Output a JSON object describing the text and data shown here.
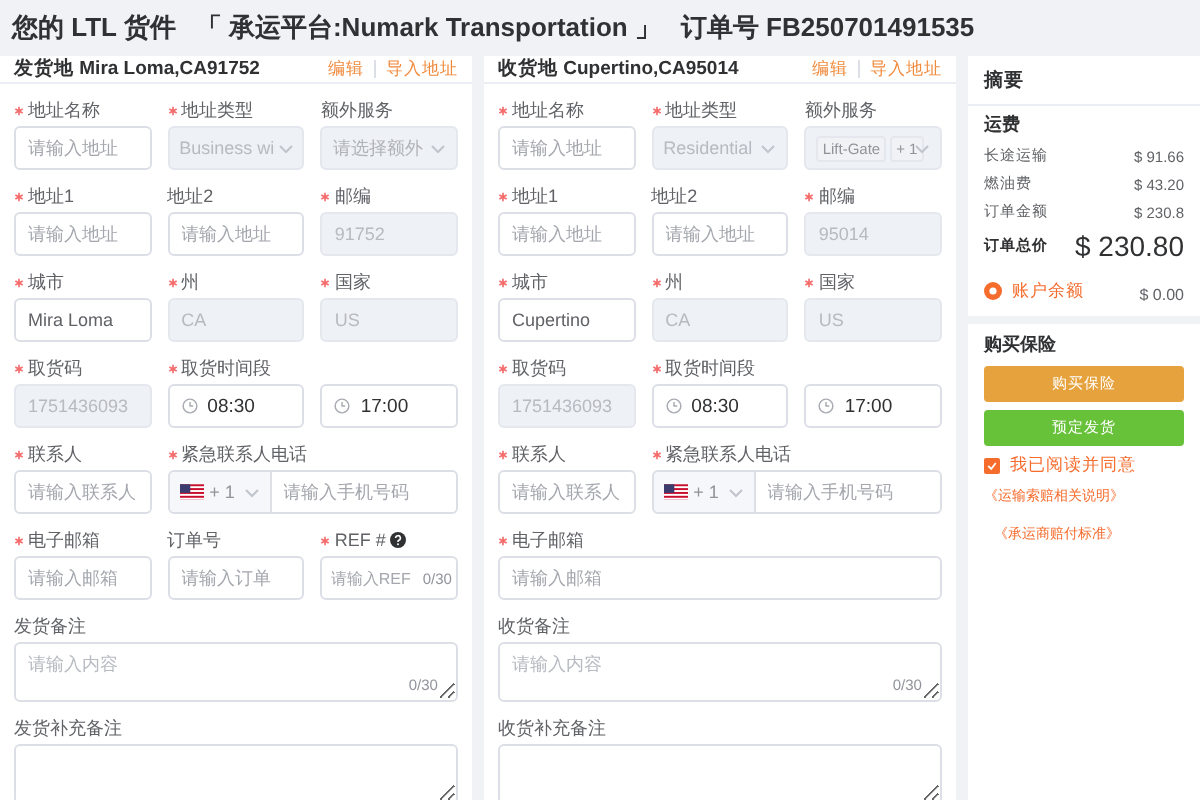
{
  "header": {
    "title": "您的 LTL 货件",
    "carrier": "「 承运平台:Numark Transportation 」",
    "order_number": "订单号 FB250701491535"
  },
  "panels": [
    {
      "title": "发货地 Mira Loma,CA91752",
      "actions": [
        "编辑",
        "导入地址"
      ],
      "fields": [
        {
          "kind": "input",
          "label": "地址名称",
          "required": true,
          "disabled": false,
          "placeholder": "请输入地址"
        },
        {
          "kind": "select",
          "label": "地址类型",
          "required": true,
          "disabled": true,
          "value": "Business wi"
        },
        {
          "kind": "select",
          "label": "额外服务",
          "required": false,
          "disabled": true,
          "placeholder": "请选择额外"
        },
        {
          "kind": "input",
          "label": "地址1",
          "required": true,
          "disabled": false,
          "placeholder": "请输入地址"
        },
        {
          "kind": "input",
          "label": "地址2",
          "required": false,
          "disabled": false,
          "placeholder": "请输入地址"
        },
        {
          "kind": "input",
          "label": "邮编",
          "required": true,
          "disabled": true,
          "value": "91752"
        },
        {
          "kind": "input",
          "label": "城市",
          "required": true,
          "disabled": false,
          "value": "Mira Loma"
        },
        {
          "kind": "input",
          "label": "州",
          "required": true,
          "disabled": true,
          "value": "CA"
        },
        {
          "kind": "input",
          "label": "国家",
          "required": true,
          "disabled": true,
          "value": "US"
        },
        {
          "kind": "input",
          "label": "取货码",
          "required": true,
          "disabled": true,
          "value": "1751436093"
        },
        {
          "kind": "time_range",
          "label": "取货时间段",
          "required": true,
          "times": [
            "08:30",
            "17:00"
          ]
        },
        {
          "kind": "input",
          "label": "联系人",
          "required": true,
          "disabled": false,
          "placeholder": "请输入联系人"
        },
        {
          "kind": "phone",
          "label": "紧急联系人电话",
          "required": true,
          "code": "+ 1",
          "placeholder": "请输入手机号码"
        },
        {
          "kind": "input",
          "label": "电子邮箱",
          "required": true,
          "disabled": false,
          "placeholder": "请输入邮箱"
        },
        {
          "kind": "input",
          "label": "订单号",
          "required": false,
          "disabled": false,
          "placeholder": "请输入订单"
        },
        {
          "kind": "counted",
          "label": "REF #",
          "required": true,
          "placeholder": "请输入REF",
          "counter": "0/30"
        },
        {
          "kind": "textarea",
          "label": "发货备注",
          "required": false,
          "placeholder": "请输入内容",
          "counter": "0/30"
        },
        {
          "kind": "textarea",
          "label": "发货补充备注",
          "required": false
        }
      ]
    },
    {
      "title": "收货地 Cupertino,CA95014",
      "actions": [
        "编辑",
        "导入地址"
      ],
      "fields": [
        {
          "kind": "input",
          "label": "地址名称",
          "required": true,
          "disabled": false,
          "placeholder": "请输入地址"
        },
        {
          "kind": "select",
          "label": "地址类型",
          "required": true,
          "disabled": true,
          "value": "Residential"
        },
        {
          "kind": "select",
          "label": "额外服务",
          "required": false,
          "disabled": true,
          "tags": [
            "Lift-Gate",
            "+ 1"
          ]
        },
        {
          "kind": "input",
          "label": "地址1",
          "required": true,
          "disabled": false,
          "placeholder": "请输入地址"
        },
        {
          "kind": "input",
          "label": "地址2",
          "required": false,
          "disabled": false,
          "placeholder": "请输入地址"
        },
        {
          "kind": "input",
          "label": "邮编",
          "required": true,
          "disabled": true,
          "value": "95014"
        },
        {
          "kind": "input",
          "label": "城市",
          "required": true,
          "disabled": false,
          "value": "Cupertino"
        },
        {
          "kind": "input",
          "label": "州",
          "required": true,
          "disabled": true,
          "value": "CA"
        },
        {
          "kind": "input",
          "label": "国家",
          "required": true,
          "disabled": true,
          "value": "US"
        },
        {
          "kind": "input",
          "label": "取货码",
          "required": true,
          "disabled": true,
          "value": "1751436093"
        },
        {
          "kind": "time_range",
          "label": "取货时间段",
          "required": true,
          "times": [
            "08:30",
            "17:00"
          ]
        },
        {
          "kind": "input",
          "label": "联系人",
          "required": true,
          "disabled": false,
          "placeholder": "请输入联系人"
        },
        {
          "kind": "phone",
          "label": "紧急联系人电话",
          "required": true,
          "code": "+ 1",
          "placeholder": "请输入手机号码"
        },
        {
          "kind": "wide_input",
          "label": "电子邮箱",
          "required": true,
          "disabled": false,
          "placeholder": "请输入邮箱"
        },
        {
          "kind": "textarea",
          "label": "收货备注",
          "required": false,
          "placeholder": "请输入内容",
          "counter": "0/30"
        },
        {
          "kind": "textarea",
          "label": "收货补充备注",
          "required": false
        }
      ]
    }
  ],
  "summary": {
    "title": "摘要",
    "section": "运费",
    "lines": [
      {
        "label": "长途运输",
        "amount": "$ 91.66"
      },
      {
        "label": "燃油费",
        "amount": "$ 43.20"
      },
      {
        "label": "订单金额",
        "amount": "$ 230.8"
      }
    ],
    "total": {
      "label": "订单总价",
      "amount": "$ 230.80"
    },
    "payment": {
      "label": "账户余额",
      "amount": "$ 0.00",
      "selected": true
    },
    "insurance_title": "购买保险",
    "buttons": [
      {
        "label": "购买保险",
        "kind": "warning"
      },
      {
        "label": "预定发货",
        "kind": "success"
      }
    ],
    "agreement": {
      "label": "我已阅读并同意",
      "checked": true
    },
    "links": [
      "《运输索赔相关说明》",
      "《承运商赔付标准》"
    ]
  }
}
